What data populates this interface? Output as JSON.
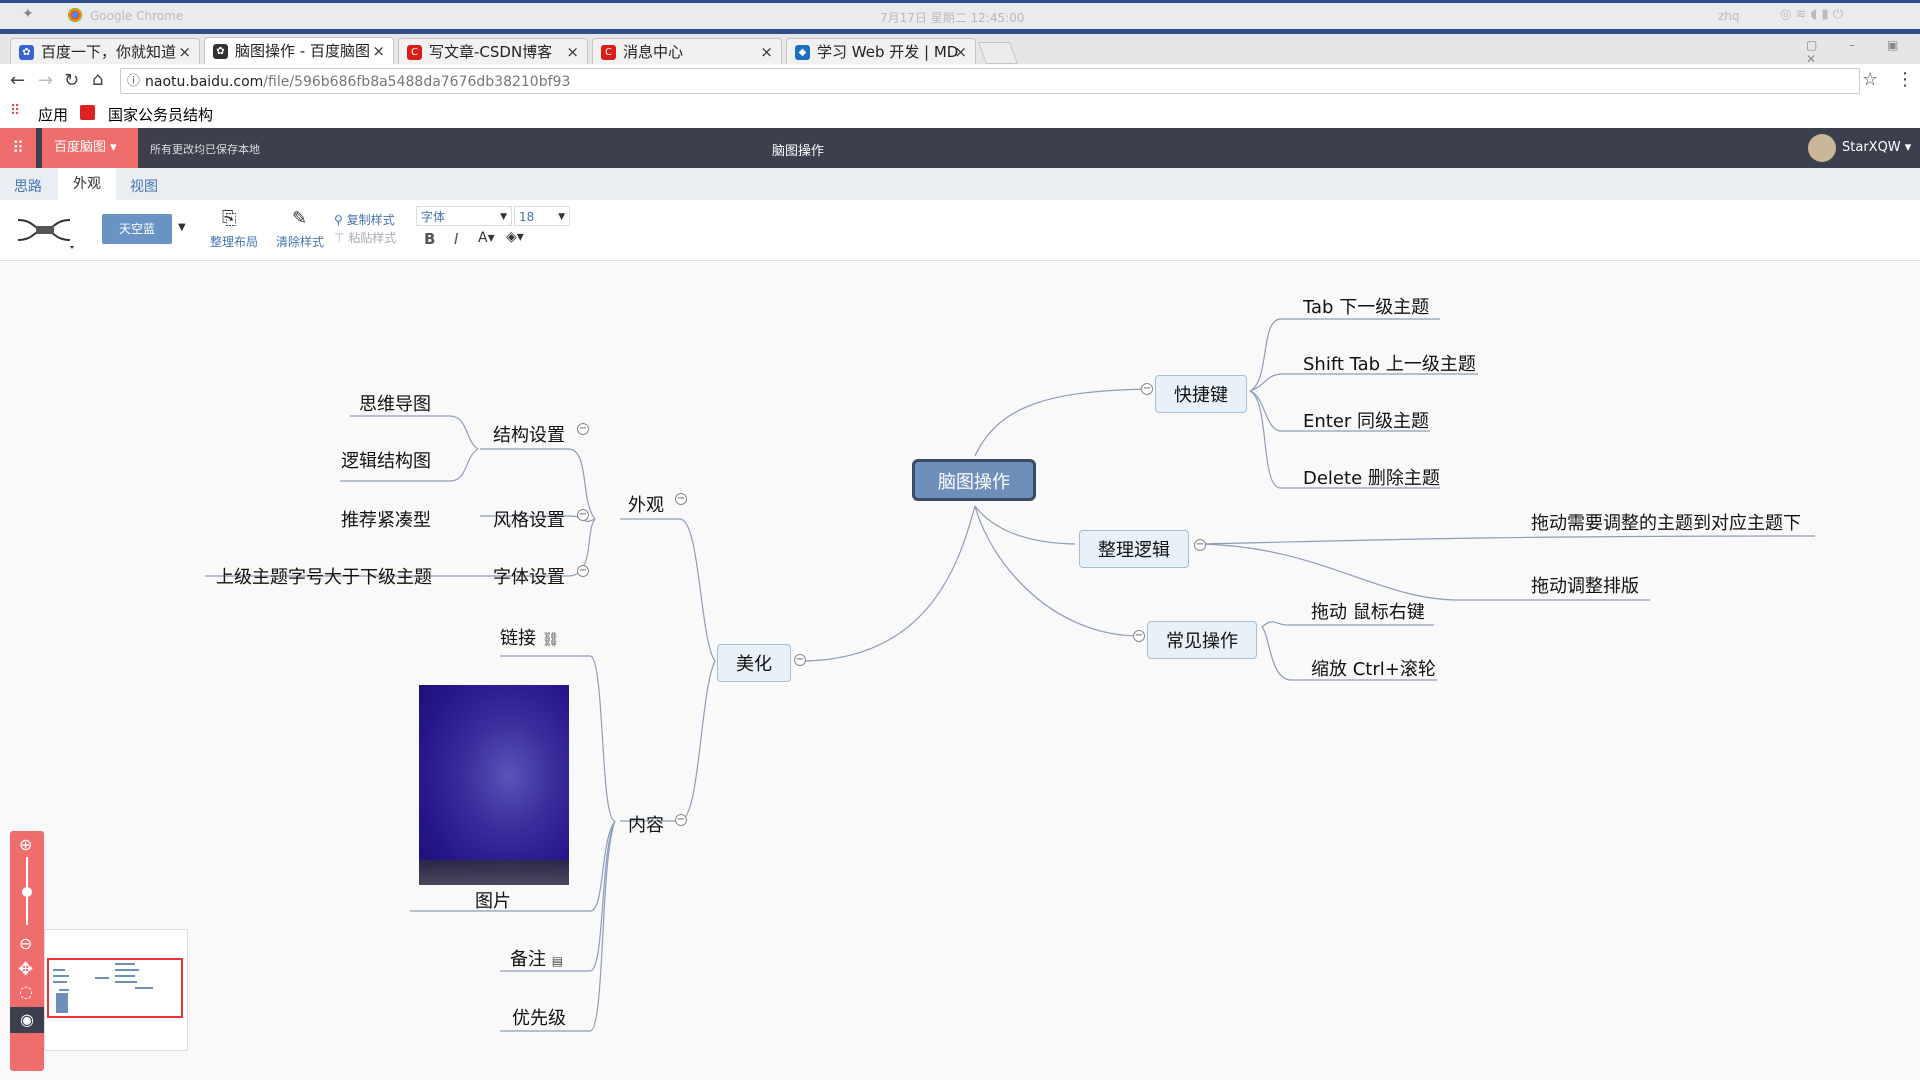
{
  "os": {
    "app": "Google Chrome",
    "datetime": "7月17日 星期二 12:45:00",
    "user": "zhq"
  },
  "tabs": [
    {
      "label": "百度一下，你就知道",
      "color": "#3862d6"
    },
    {
      "label": "脑图操作 - 百度脑图",
      "color": "#333333"
    },
    {
      "label": "写文章-CSDN博客",
      "color": "#d91e18"
    },
    {
      "label": "消息中心",
      "color": "#d91e18"
    },
    {
      "label": "学习 Web 开发 | MD",
      "color": "#1f6fbf"
    }
  ],
  "address": {
    "host": "naotu.baidu.com",
    "path": "/file/596b686fb8a5488da7676db38210bf93"
  },
  "bookmarks": {
    "apps": "应用",
    "item": "国家公务员结构"
  },
  "header": {
    "brand": "百度脑图",
    "saved": "所有更改均已保存本地",
    "title": "脑图操作",
    "user": "StarXQW"
  },
  "menu_tabs": [
    "思路",
    "外观",
    "视图"
  ],
  "toolbar": {
    "theme": "天空蓝",
    "arrange": "整理布局",
    "clear_style": "清除样式",
    "copy_style": "复制样式",
    "paste_style": "粘贴样式",
    "font": "字体",
    "size": "18",
    "bold": "B",
    "italic": "I",
    "font_color": "A"
  },
  "mindmap": {
    "root": "脑图操作",
    "shortcuts": "快捷键",
    "shortcut_items": [
      "Tab  下一级主题",
      "Shift Tab 上一级主题",
      "Enter 同级主题",
      "Delete 删除主题"
    ],
    "logic": "整理逻辑",
    "logic_items": [
      "拖动需要调整的主题到对应主题下",
      "拖动调整排版"
    ],
    "common": "常见操作",
    "common_items": [
      "拖动 鼠标右键",
      "缩放 Ctrl+滚轮"
    ],
    "beautify": "美化",
    "appearance": "外观",
    "structure": "结构设置",
    "structure_items": [
      "思维导图",
      "逻辑结构图"
    ],
    "style": "风格设置",
    "style_item": "推荐紧凑型",
    "fontset": "字体设置",
    "fontset_item": "上级主题字号大于下级主题",
    "content": "内容",
    "link": "链接",
    "image": "图片",
    "note": "备注",
    "priority": "优先级"
  }
}
